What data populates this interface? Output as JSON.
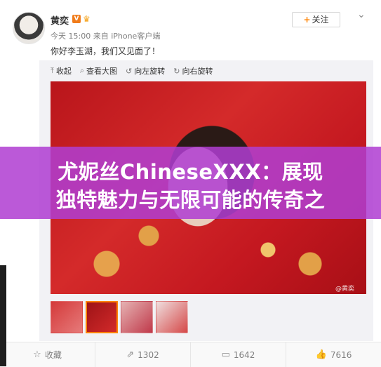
{
  "post": {
    "author": "黄奕",
    "verified_badge": "V",
    "meta": "今天 15:00 来自 iPhone客户端",
    "content": "你好李玉湖，我们又见面了！",
    "follow_label": "关注",
    "follow_plus": "+",
    "more_icon": "chevron-down-icon"
  },
  "media": {
    "toolbar": [
      {
        "icon": "collapse-icon",
        "glyph": "⤒",
        "label": "收起"
      },
      {
        "icon": "zoom-icon",
        "glyph": "🔍",
        "label": "查看大图"
      },
      {
        "icon": "rotate-left-icon",
        "glyph": "↺",
        "label": "向左旋转"
      },
      {
        "icon": "rotate-right-icon",
        "glyph": "↻",
        "label": "向右旋转"
      }
    ],
    "watermark": "@黄奕",
    "selected_thumb_index": 1
  },
  "footer": {
    "collect_label": "收藏",
    "repost_count": "1302",
    "comment_count": "1642",
    "like_count": "7616"
  },
  "banner": {
    "line1": "尤妮丝ChineseXXX：展现",
    "line2": "独特魅力与无限可能的传奇之",
    "color": "#b03ed2"
  }
}
